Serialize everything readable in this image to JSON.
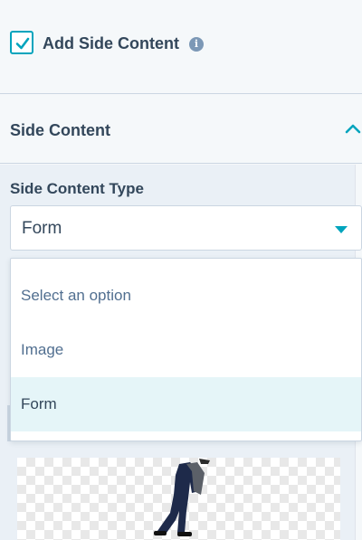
{
  "settings": {
    "add_side_content_label": "Add Side Content",
    "add_side_content_checked": true,
    "info_icon": "info-icon"
  },
  "section": {
    "title": "Side Content",
    "expanded": true,
    "toggle_icon": "chevron-up-icon"
  },
  "side_content_type": {
    "label": "Side Content Type",
    "value": "Form",
    "dropdown_icon": "caret-down-icon",
    "options": [
      {
        "label": "Select an option",
        "selected": false
      },
      {
        "label": "Image",
        "selected": false
      },
      {
        "label": "Form",
        "selected": true
      }
    ]
  },
  "colors": {
    "accent": "#00a4bd",
    "text": "#33475b",
    "selected_option_bg": "#e5f5f8"
  }
}
